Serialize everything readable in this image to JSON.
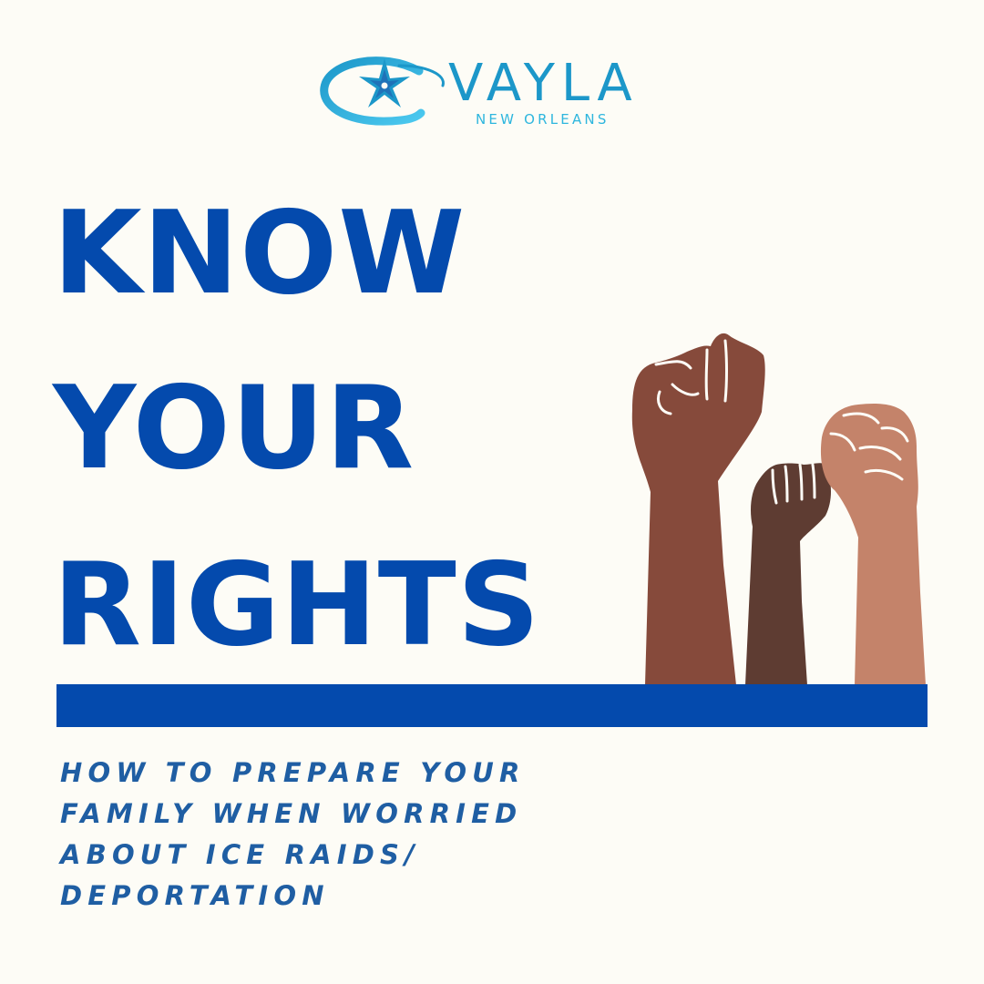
{
  "colors": {
    "background": "#fdfcf6",
    "headline": "#044aad",
    "subtitle": "#1f5ea3",
    "logo_word": "#1c97c9",
    "logo_sub": "#2eb6de",
    "fist_left": "#864a3b",
    "fist_middle": "#5e3c32",
    "fist_right": "#c4836a"
  },
  "logo": {
    "icon": "star-orbit-icon",
    "word": "VAYLA",
    "subword": "NEW ORLEANS"
  },
  "headline": {
    "lines": [
      "KNOW",
      "YOUR",
      "RIGHTS"
    ]
  },
  "illustration": {
    "icon": "raised-fists-illustration"
  },
  "subtitle": {
    "lines": [
      "HOW TO PREPARE YOUR",
      "FAMILY WHEN WORRIED",
      "ABOUT ICE RAIDS/",
      "DEPORTATION"
    ]
  }
}
